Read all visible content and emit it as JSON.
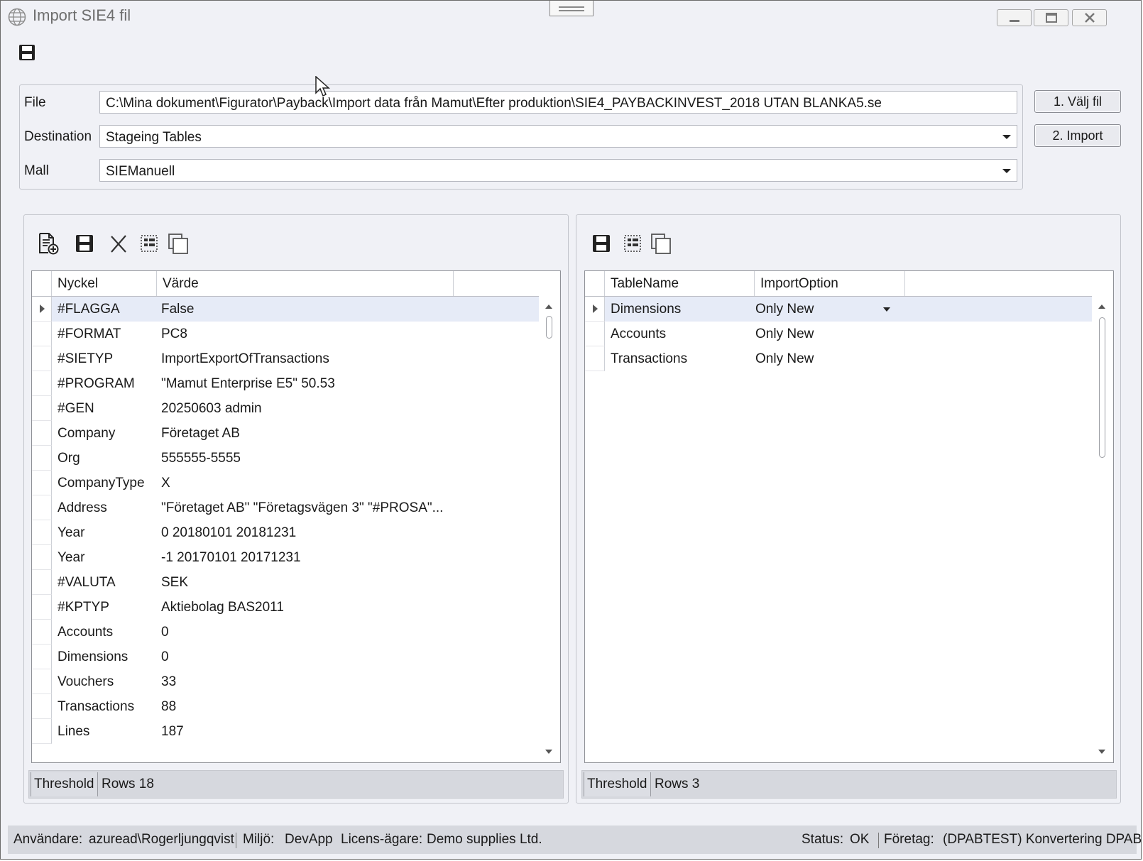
{
  "window": {
    "title": "Import SIE4 fil"
  },
  "form": {
    "file_label": "File",
    "file_value": "C:\\Mina dokument\\Figurator\\Payback\\Import data från Mamut\\Efter produktion\\SIE4_PAYBACKINVEST_2018 UTAN BLANKA5.se",
    "destination_label": "Destination",
    "destination_value": "Stageing Tables",
    "mall_label": "Mall",
    "mall_value": "SIEManuell",
    "choose_file_button": "1. Välj fil",
    "import_button": "2. Import"
  },
  "left_grid": {
    "columns": [
      "Nyckel",
      "Värde"
    ],
    "rows": [
      {
        "key": "#FLAGGA",
        "value": "False"
      },
      {
        "key": "#FORMAT",
        "value": "PC8"
      },
      {
        "key": "#SIETYP",
        "value": "ImportExportOfTransactions"
      },
      {
        "key": "#PROGRAM",
        "value": "\"Mamut Enterprise E5\" 50.53"
      },
      {
        "key": "#GEN",
        "value": "20250603 admin"
      },
      {
        "key": "Company",
        "value": "Företaget AB"
      },
      {
        "key": "Org",
        "value": "555555-5555"
      },
      {
        "key": "CompanyType",
        "value": "X"
      },
      {
        "key": "Address",
        "value": "\"Företaget AB\" \"Företagsvägen 3\" \"#PROSA\"..."
      },
      {
        "key": "Year",
        "value": "0 20180101 20181231"
      },
      {
        "key": "Year",
        "value": "-1 20170101 20171231"
      },
      {
        "key": "#VALUTA",
        "value": "SEK"
      },
      {
        "key": "#KPTYP",
        "value": "Aktiebolag BAS2011"
      },
      {
        "key": "Accounts",
        "value": "0"
      },
      {
        "key": "Dimensions",
        "value": "0"
      },
      {
        "key": "Vouchers",
        "value": "33"
      },
      {
        "key": "Transactions",
        "value": "88"
      },
      {
        "key": "Lines",
        "value": "187"
      }
    ],
    "threshold_label": "Threshold",
    "rows_label": "Rows 18"
  },
  "right_grid": {
    "columns": [
      "TableName",
      "ImportOption"
    ],
    "rows": [
      {
        "name": "Dimensions",
        "option": "Only New"
      },
      {
        "name": "Accounts",
        "option": "Only New"
      },
      {
        "name": "Transactions",
        "option": "Only New"
      }
    ],
    "threshold_label": "Threshold",
    "rows_label": "Rows 3"
  },
  "statusbar": {
    "user_label": "Användare:",
    "user_value": "azuread\\Rogerljungqvist",
    "env_label": "Miljö:",
    "env_value": "DevApp",
    "license_label": "Licens-ägare:",
    "license_value": "Demo supplies Ltd.",
    "status_label": "Status:",
    "status_value": "OK",
    "company_label": "Företag:",
    "company_value": "(DPABTEST) Konvertering DPAB"
  }
}
